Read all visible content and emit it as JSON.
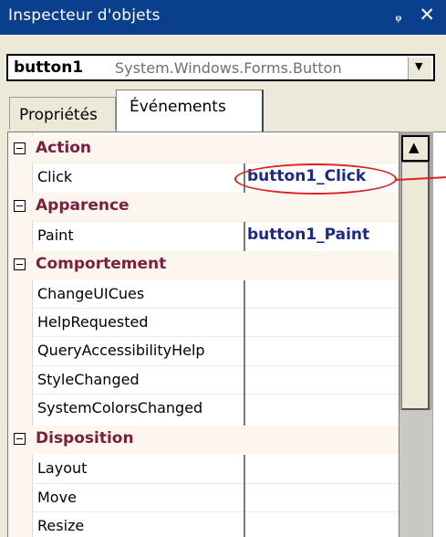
{
  "title": "Inspecteur d'objets",
  "titlebar": {
    "pin_glyph": "ᵩ",
    "close_glyph": "✕"
  },
  "selector": {
    "object": "button1",
    "type": "System.Windows.Forms.Button",
    "dropdown_glyph": "▼"
  },
  "tabs": [
    {
      "label": "Propriétés"
    },
    {
      "label": "Événements"
    }
  ],
  "grid": {
    "rows": [
      {
        "kind": "category",
        "label": "Action"
      },
      {
        "kind": "event",
        "name": "Click",
        "value": "button1_Click"
      },
      {
        "kind": "category",
        "label": "Apparence"
      },
      {
        "kind": "event",
        "name": "Paint",
        "value": "button1_Paint"
      },
      {
        "kind": "category",
        "label": "Comportement"
      },
      {
        "kind": "event",
        "name": "ChangeUICues",
        "value": ""
      },
      {
        "kind": "event",
        "name": "HelpRequested",
        "value": ""
      },
      {
        "kind": "event",
        "name": "QueryAccessibilityHelp",
        "value": ""
      },
      {
        "kind": "event",
        "name": "StyleChanged",
        "value": ""
      },
      {
        "kind": "event",
        "name": "SystemColorsChanged",
        "value": ""
      },
      {
        "kind": "category",
        "label": "Disposition"
      },
      {
        "kind": "event",
        "name": "Layout",
        "value": ""
      },
      {
        "kind": "event",
        "name": "Move",
        "value": ""
      },
      {
        "kind": "event",
        "name": "Resize",
        "value": ""
      }
    ]
  },
  "scrollbar": {
    "up_glyph": "▲"
  },
  "colors": {
    "titlebar": "#0a3f8e",
    "category_text": "#7a1f3c",
    "value_text": "#1b2a8a",
    "annotation": "#e02020"
  }
}
